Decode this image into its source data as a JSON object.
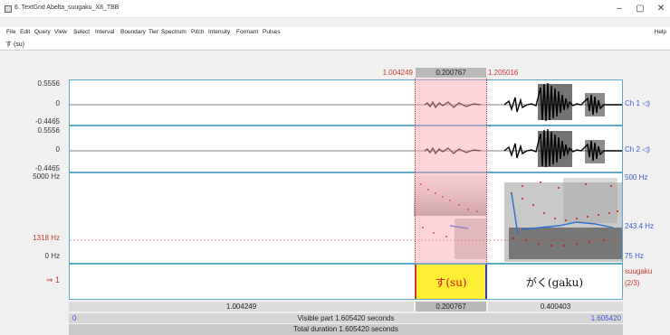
{
  "window": {
    "title": "6. TextGrid Abelta_suugaku_X8_TBB"
  },
  "menu": [
    "File",
    "Edit",
    "Query",
    "View",
    "Select",
    "Interval",
    "Boundary",
    "Tier",
    "Spectrum",
    "Pitch",
    "Intensity",
    "Formant",
    "Pulses"
  ],
  "menu_help": "Help",
  "tier_name_field": "す (su)",
  "selection": {
    "start": "1.004249",
    "duration": "0.200767",
    "end": "1.205016"
  },
  "waveform": {
    "ch1": {
      "max": "0.5556",
      "zero": "0",
      "min": "-0.4465",
      "label": "Ch 1"
    },
    "ch2": {
      "max": "0.5556",
      "zero": "0",
      "min": "-0.4465",
      "label": "Ch 2"
    }
  },
  "spectrogram": {
    "max_freq": "5000 Hz",
    "cursor_freq": "1318 Hz",
    "min_freq": "0 Hz",
    "pitch_top": "500 Hz",
    "pitch_mid": "243.4 Hz",
    "pitch_bottom": "75 Hz"
  },
  "textgrid": {
    "tier_number": "1",
    "intervals": [
      {
        "text": ""
      },
      {
        "text": "す(su)"
      },
      {
        "text": "がく(gaku)"
      }
    ],
    "tier_name": "suugaku",
    "tier_count": "(2/3)"
  },
  "bottom": {
    "interval_durations": [
      "1.004249",
      "0.200767",
      "0.400403"
    ],
    "visible_start": "0",
    "visible_label": "Visible part 1.605420 seconds",
    "visible_end": "1.605420",
    "total_label": "Total duration 1.605420 seconds"
  },
  "colors": {
    "panel_border": "#5fa8c9",
    "selection": "#ffa0af",
    "selected_interval": "#ffee33",
    "pitch": "#2b6fd6",
    "formant": "#d01818",
    "time_red": "#c0392b",
    "freq_blue": "#3a5bc7"
  }
}
